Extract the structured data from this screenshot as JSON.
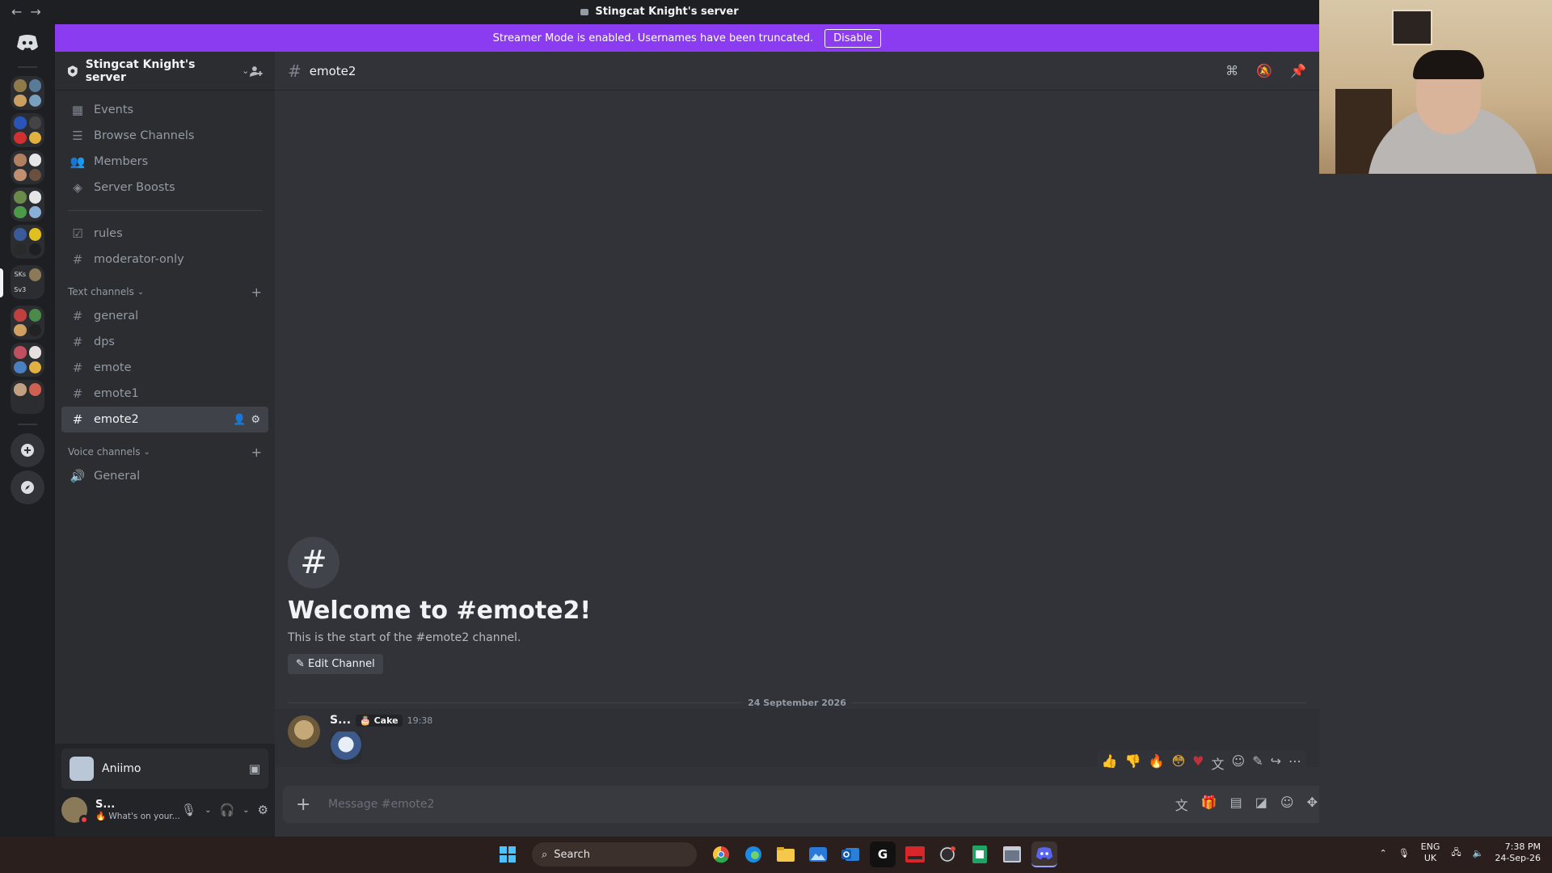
{
  "window": {
    "title": "Stingcat Knight's server",
    "back_label": "←",
    "forward_label": "→"
  },
  "banner": {
    "text": "Streamer Mode is enabled. Usernames have been truncated.",
    "disable_label": "Disable"
  },
  "rail": {
    "folder_labels": [
      "SKs",
      "Sv3"
    ]
  },
  "server": {
    "name": "Stingcat Knight's server"
  },
  "sidebar": {
    "top_items": [
      {
        "label": "Events",
        "icon": "calendar-icon"
      },
      {
        "label": "Browse Channels",
        "icon": "browse-channels-icon"
      },
      {
        "label": "Members",
        "icon": "members-icon"
      },
      {
        "label": "Server Boosts",
        "icon": "boost-icon"
      }
    ],
    "special_channels": [
      {
        "label": "rules",
        "icon": "rules-checkbox-icon"
      },
      {
        "label": "moderator-only",
        "icon": "hash-lock-icon"
      }
    ],
    "text_category": "Text channels",
    "text_channels": [
      "general",
      "dps",
      "emote",
      "emote1",
      "emote2"
    ],
    "active_channel": "emote2",
    "voice_category": "Voice channels",
    "voice_channels": [
      "General"
    ]
  },
  "user_panel": {
    "activity_name": "Aniimo",
    "username": "S...",
    "status_text": "What's on your..."
  },
  "channel": {
    "name": "emote2",
    "welcome_title": "Welcome to #emote2!",
    "welcome_desc": "This is the start of the #emote2 channel.",
    "edit_label": "Edit Channel"
  },
  "messages": {
    "date_divider": "24 September 2026",
    "author": "S...",
    "badge": "Cake",
    "time": "19:38"
  },
  "composer": {
    "placeholder": "Message #emote2"
  },
  "taskbar": {
    "search_label": "Search",
    "lang_1": "ENG",
    "lang_2": "UK",
    "time": "7:38 PM",
    "date": "24-Sep-26"
  },
  "colors": {
    "banner": "#8c3cf0",
    "background": "#313338",
    "sidebar": "#2b2d31",
    "rail": "#1e1f22",
    "status_dnd": "#f23f43"
  }
}
